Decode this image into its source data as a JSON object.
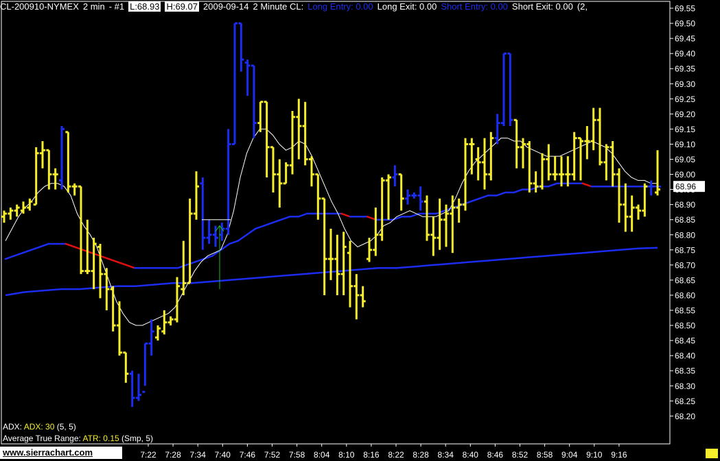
{
  "header": {
    "symbol": "CL-200910-NYMEX",
    "interval": "2 min",
    "chart_num": "- #1",
    "low": "L:68.93",
    "high": "H:69.07",
    "date": "2009-09-14",
    "study_name": "2 Minute CL:",
    "long_entry": "Long Entry: 0.00",
    "long_exit": "Long Exit: 0.00",
    "short_entry": "Short Entry: 0.00",
    "short_exit": "Short Exit: 0.00",
    "tail": "(2,"
  },
  "studies": {
    "adx_label": "ADX:",
    "adx_value": "ADX: 30",
    "adx_params": "(5, 5)",
    "atr_label": "Average True Range:",
    "atr_value": "ATR: 0.15",
    "atr_params": "(Smp, 5)"
  },
  "brand": "www.sierrachart.com",
  "colors": {
    "bar_up": "#f6ee2c",
    "bar_down": "#1c2cf0",
    "ma_fast": "#ffffff",
    "ma_blue": "#1c2cf0",
    "ma_red": "#e01010",
    "signal": "#18c018",
    "grid": "#ffffff"
  },
  "chart_data": {
    "type": "ohlc",
    "title": "CL-200910-NYMEX 2 min",
    "y_ticks": [
      "69.55",
      "69.50",
      "69.45",
      "69.40",
      "69.35",
      "69.30",
      "69.25",
      "69.20",
      "69.15",
      "69.10",
      "69.05",
      "69.00",
      "68.95",
      "68.90",
      "68.85",
      "68.80",
      "68.75",
      "68.70",
      "68.65",
      "68.60",
      "68.55",
      "68.50",
      "68.45",
      "68.40",
      "68.35",
      "68.30",
      "68.25",
      "68.20"
    ],
    "ylim": [
      68.15,
      69.58
    ],
    "last_price": "68.96",
    "x_ticks": [
      "7:22",
      "7:28",
      "7:34",
      "7:40",
      "7:46",
      "7:52",
      "7:58",
      "8:04",
      "8:10",
      "8:16",
      "8:22",
      "8:28",
      "8:34",
      "8:40",
      "8:46",
      "8:52",
      "8:58",
      "9:04",
      "9:10",
      "9:16"
    ],
    "bars": [
      {
        "o": 68.86,
        "h": 68.88,
        "l": 68.84,
        "c": 68.87,
        "d": "up"
      },
      {
        "o": 68.87,
        "h": 68.89,
        "l": 68.85,
        "c": 68.88,
        "d": "up"
      },
      {
        "o": 68.88,
        "h": 68.9,
        "l": 68.86,
        "c": 68.89,
        "d": "up"
      },
      {
        "o": 68.88,
        "h": 68.91,
        "l": 68.87,
        "c": 68.89,
        "d": "up"
      },
      {
        "o": 68.89,
        "h": 68.92,
        "l": 68.88,
        "c": 68.91,
        "d": "up"
      },
      {
        "o": 68.9,
        "h": 69.09,
        "l": 68.9,
        "c": 69.07,
        "d": "up"
      },
      {
        "o": 69.07,
        "h": 69.11,
        "l": 69.02,
        "c": 69.08,
        "d": "up"
      },
      {
        "o": 69.08,
        "h": 69.08,
        "l": 68.95,
        "c": 69.0,
        "d": "up"
      },
      {
        "o": 69.0,
        "h": 69.02,
        "l": 68.95,
        "c": 69.0,
        "d": "up"
      },
      {
        "o": 68.98,
        "h": 69.16,
        "l": 68.95,
        "c": 69.15,
        "d": "down"
      },
      {
        "o": 69.14,
        "h": 69.14,
        "l": 68.94,
        "c": 68.96,
        "d": "up"
      },
      {
        "o": 68.96,
        "h": 68.97,
        "l": 68.93,
        "c": 68.96,
        "d": "up"
      },
      {
        "o": 68.96,
        "h": 68.96,
        "l": 68.67,
        "c": 68.68,
        "d": "up"
      },
      {
        "o": 68.68,
        "h": 68.85,
        "l": 68.67,
        "c": 68.68,
        "d": "up"
      },
      {
        "o": 68.68,
        "h": 68.79,
        "l": 68.62,
        "c": 68.77,
        "d": "up"
      },
      {
        "o": 68.76,
        "h": 68.77,
        "l": 68.59,
        "c": 68.67,
        "d": "up"
      },
      {
        "o": 68.67,
        "h": 68.69,
        "l": 68.55,
        "c": 68.62,
        "d": "up"
      },
      {
        "o": 68.62,
        "h": 68.63,
        "l": 68.48,
        "c": 68.5,
        "d": "up"
      },
      {
        "o": 68.5,
        "h": 68.58,
        "l": 68.4,
        "c": 68.41,
        "d": "up"
      },
      {
        "o": 68.41,
        "h": 68.41,
        "l": 68.31,
        "c": 68.34,
        "d": "up"
      },
      {
        "o": 68.34,
        "h": 68.35,
        "l": 68.23,
        "c": 68.26,
        "d": "down"
      },
      {
        "o": 68.26,
        "h": 68.34,
        "l": 68.25,
        "c": 68.27,
        "d": "down"
      },
      {
        "o": 68.28,
        "h": 68.44,
        "l": 68.3,
        "c": 68.44,
        "d": "down"
      },
      {
        "o": 68.44,
        "h": 68.52,
        "l": 68.4,
        "c": 68.48,
        "d": "down"
      },
      {
        "o": 68.46,
        "h": 68.5,
        "l": 68.45,
        "c": 68.49,
        "d": "up"
      },
      {
        "o": 68.48,
        "h": 68.55,
        "l": 68.47,
        "c": 68.51,
        "d": "up"
      },
      {
        "o": 68.51,
        "h": 68.53,
        "l": 68.5,
        "c": 68.52,
        "d": "up"
      },
      {
        "o": 68.52,
        "h": 68.66,
        "l": 68.51,
        "c": 68.63,
        "d": "up"
      },
      {
        "o": 68.62,
        "h": 68.78,
        "l": 68.6,
        "c": 68.64,
        "d": "up"
      },
      {
        "o": 68.64,
        "h": 68.92,
        "l": 68.64,
        "c": 68.87,
        "d": "up"
      },
      {
        "o": 68.87,
        "h": 69.01,
        "l": 68.85,
        "c": 68.96,
        "d": "up"
      },
      {
        "o": 68.97,
        "h": 68.99,
        "l": 68.75,
        "c": 68.79,
        "d": "down"
      },
      {
        "o": 68.79,
        "h": 68.85,
        "l": 68.77,
        "c": 68.8,
        "d": "down"
      },
      {
        "o": 68.8,
        "h": 68.83,
        "l": 68.76,
        "c": 68.79,
        "d": "down"
      },
      {
        "o": 68.8,
        "h": 68.84,
        "l": 68.78,
        "c": 68.82,
        "d": "down"
      },
      {
        "o": 68.82,
        "h": 69.15,
        "l": 68.8,
        "c": 69.1,
        "d": "down"
      },
      {
        "o": 69.1,
        "h": 69.5,
        "l": 69.1,
        "c": 69.5,
        "d": "down"
      },
      {
        "o": 69.5,
        "h": 69.5,
        "l": 69.34,
        "c": 69.38,
        "d": "down"
      },
      {
        "o": 69.37,
        "h": 69.38,
        "l": 69.26,
        "c": 69.36,
        "d": "down"
      },
      {
        "o": 69.36,
        "h": 69.36,
        "l": 69.12,
        "c": 69.17,
        "d": "down"
      },
      {
        "o": 69.17,
        "h": 69.24,
        "l": 69.14,
        "c": 69.24,
        "d": "up"
      },
      {
        "o": 69.24,
        "h": 69.24,
        "l": 68.99,
        "c": 69.09,
        "d": "up"
      },
      {
        "o": 69.09,
        "h": 69.09,
        "l": 68.94,
        "c": 69.0,
        "d": "up"
      },
      {
        "o": 69.0,
        "h": 69.05,
        "l": 68.89,
        "c": 68.97,
        "d": "up"
      },
      {
        "o": 68.97,
        "h": 69.04,
        "l": 68.97,
        "c": 69.03,
        "d": "up"
      },
      {
        "o": 69.03,
        "h": 69.21,
        "l": 69.0,
        "c": 69.19,
        "d": "up"
      },
      {
        "o": 69.19,
        "h": 69.25,
        "l": 69.05,
        "c": 69.16,
        "d": "up"
      },
      {
        "o": 69.16,
        "h": 69.24,
        "l": 69.03,
        "c": 69.05,
        "d": "up"
      },
      {
        "o": 69.05,
        "h": 69.06,
        "l": 68.96,
        "c": 69.0,
        "d": "up"
      },
      {
        "o": 69.0,
        "h": 69.0,
        "l": 68.85,
        "c": 68.92,
        "d": "up"
      },
      {
        "o": 68.92,
        "h": 68.92,
        "l": 68.6,
        "c": 68.72,
        "d": "up"
      },
      {
        "o": 68.72,
        "h": 68.82,
        "l": 68.65,
        "c": 68.72,
        "d": "up"
      },
      {
        "o": 68.72,
        "h": 68.8,
        "l": 68.6,
        "c": 68.67,
        "d": "up"
      },
      {
        "o": 68.67,
        "h": 68.81,
        "l": 68.6,
        "c": 68.76,
        "d": "up"
      },
      {
        "o": 68.74,
        "h": 68.78,
        "l": 68.56,
        "c": 68.63,
        "d": "up"
      },
      {
        "o": 68.63,
        "h": 68.67,
        "l": 68.52,
        "c": 68.6,
        "d": "up"
      },
      {
        "o": 68.6,
        "h": 68.63,
        "l": 68.56,
        "c": 68.58,
        "d": "up"
      },
      {
        "o": 68.72,
        "h": 68.79,
        "l": 68.71,
        "c": 68.75,
        "d": "up"
      },
      {
        "o": 68.75,
        "h": 68.89,
        "l": 68.73,
        "c": 68.8,
        "d": "up"
      },
      {
        "o": 68.8,
        "h": 68.99,
        "l": 68.78,
        "c": 68.98,
        "d": "up"
      },
      {
        "o": 68.98,
        "h": 69.0,
        "l": 68.85,
        "c": 68.99,
        "d": "up"
      },
      {
        "o": 68.99,
        "h": 69.03,
        "l": 68.96,
        "c": 69.0,
        "d": "down"
      },
      {
        "o": 69.0,
        "h": 69.0,
        "l": 68.88,
        "c": 68.92,
        "d": "up"
      },
      {
        "o": 68.92,
        "h": 68.95,
        "l": 68.9,
        "c": 68.93,
        "d": "down"
      },
      {
        "o": 68.93,
        "h": 68.94,
        "l": 68.92,
        "c": 68.93,
        "d": "down"
      },
      {
        "o": 68.93,
        "h": 68.96,
        "l": 68.88,
        "c": 68.91,
        "d": "down"
      },
      {
        "o": 68.91,
        "h": 68.93,
        "l": 68.78,
        "c": 68.8,
        "d": "up"
      },
      {
        "o": 68.8,
        "h": 68.86,
        "l": 68.73,
        "c": 68.79,
        "d": "up"
      },
      {
        "o": 68.79,
        "h": 68.92,
        "l": 68.75,
        "c": 68.85,
        "d": "up"
      },
      {
        "o": 68.85,
        "h": 68.9,
        "l": 68.76,
        "c": 68.87,
        "d": "up"
      },
      {
        "o": 68.87,
        "h": 68.93,
        "l": 68.74,
        "c": 68.89,
        "d": "up"
      },
      {
        "o": 68.89,
        "h": 68.92,
        "l": 68.84,
        "c": 68.9,
        "d": "up"
      },
      {
        "o": 68.9,
        "h": 69.12,
        "l": 68.88,
        "c": 69.1,
        "d": "up"
      },
      {
        "o": 69.1,
        "h": 69.12,
        "l": 69.0,
        "c": 69.1,
        "d": "up"
      },
      {
        "o": 69.05,
        "h": 69.09,
        "l": 68.98,
        "c": 69.04,
        "d": "up"
      },
      {
        "o": 69.04,
        "h": 69.12,
        "l": 68.95,
        "c": 69.0,
        "d": "up"
      },
      {
        "o": 69.0,
        "h": 69.14,
        "l": 68.98,
        "c": 69.12,
        "d": "up"
      },
      {
        "o": 69.12,
        "h": 69.2,
        "l": 69.1,
        "c": 69.17,
        "d": "down"
      },
      {
        "o": 69.17,
        "h": 69.4,
        "l": 69.16,
        "c": 69.4,
        "d": "down"
      },
      {
        "o": 69.4,
        "h": 69.4,
        "l": 69.16,
        "c": 69.18,
        "d": "down"
      },
      {
        "o": 69.18,
        "h": 69.18,
        "l": 69.02,
        "c": 69.09,
        "d": "up"
      },
      {
        "o": 69.09,
        "h": 69.12,
        "l": 69.02,
        "c": 69.1,
        "d": "up"
      },
      {
        "o": 69.1,
        "h": 69.11,
        "l": 68.94,
        "c": 68.97,
        "d": "up"
      },
      {
        "o": 68.97,
        "h": 69.01,
        "l": 68.94,
        "c": 68.96,
        "d": "up"
      },
      {
        "o": 68.96,
        "h": 69.07,
        "l": 68.95,
        "c": 69.05,
        "d": "up"
      },
      {
        "o": 69.05,
        "h": 69.1,
        "l": 68.98,
        "c": 69.0,
        "d": "up"
      },
      {
        "o": 69.0,
        "h": 69.06,
        "l": 68.98,
        "c": 69.0,
        "d": "up"
      },
      {
        "o": 69.0,
        "h": 69.06,
        "l": 68.96,
        "c": 69.0,
        "d": "up"
      },
      {
        "o": 69.0,
        "h": 69.06,
        "l": 68.96,
        "c": 69.0,
        "d": "up"
      },
      {
        "o": 69.0,
        "h": 69.14,
        "l": 68.98,
        "c": 69.12,
        "d": "up"
      },
      {
        "o": 69.12,
        "h": 69.12,
        "l": 68.98,
        "c": 69.11,
        "d": "up"
      },
      {
        "o": 69.11,
        "h": 69.16,
        "l": 69.05,
        "c": 69.11,
        "d": "up"
      },
      {
        "o": 69.11,
        "h": 69.22,
        "l": 69.08,
        "c": 69.18,
        "d": "up"
      },
      {
        "o": 69.18,
        "h": 69.22,
        "l": 69.03,
        "c": 69.04,
        "d": "up"
      },
      {
        "o": 69.04,
        "h": 69.1,
        "l": 68.98,
        "c": 69.09,
        "d": "up"
      },
      {
        "o": 69.09,
        "h": 69.11,
        "l": 68.96,
        "c": 69.0,
        "d": "up"
      },
      {
        "o": 69.0,
        "h": 69.02,
        "l": 68.84,
        "c": 68.9,
        "d": "up"
      },
      {
        "o": 68.9,
        "h": 68.97,
        "l": 68.81,
        "c": 68.86,
        "d": "up"
      },
      {
        "o": 68.86,
        "h": 68.93,
        "l": 68.81,
        "c": 68.89,
        "d": "up"
      },
      {
        "o": 68.89,
        "h": 68.9,
        "l": 68.85,
        "c": 68.88,
        "d": "up"
      },
      {
        "o": 68.88,
        "h": 68.97,
        "l": 68.86,
        "c": 68.96,
        "d": "up"
      },
      {
        "o": 68.96,
        "h": 68.98,
        "l": 68.93,
        "c": 68.96,
        "d": "down"
      },
      {
        "o": 68.94,
        "h": 69.08,
        "l": 68.93,
        "c": 68.95,
        "d": "up"
      }
    ],
    "ma_fast": [
      68.78,
      68.82,
      68.86,
      68.89,
      68.91,
      68.94,
      68.96,
      68.97,
      68.97,
      68.96,
      68.93,
      68.87,
      68.83,
      68.8,
      68.76,
      68.7,
      68.64,
      68.58,
      68.54,
      68.51,
      68.5,
      68.5,
      68.51,
      68.52,
      68.53,
      68.54,
      68.56,
      68.6,
      68.64,
      68.68,
      68.71,
      68.73,
      68.74,
      68.75,
      68.8,
      68.88,
      68.99,
      69.07,
      69.12,
      69.15,
      69.15,
      69.13,
      69.1,
      69.08,
      69.09,
      69.11,
      69.1,
      69.06,
      69.01,
      68.96,
      68.91,
      68.87,
      68.82,
      68.78,
      68.76,
      68.77,
      68.78,
      68.8,
      68.83,
      68.84,
      68.86,
      68.87,
      68.88,
      68.87,
      68.86,
      68.86,
      68.86,
      68.87,
      68.88,
      68.92,
      68.97,
      69.01,
      69.04,
      69.06,
      69.08,
      69.1,
      69.12,
      69.12,
      69.11,
      69.11,
      69.09,
      69.08,
      69.07,
      69.06,
      69.06,
      69.06,
      69.07,
      69.08,
      69.09,
      69.1,
      69.11,
      69.1,
      69.09,
      69.07,
      69.04,
      69.01,
      68.99,
      68.98,
      68.98,
      68.97,
      68.97
    ],
    "ma_mid": [
      68.72,
      68.73,
      68.74,
      68.75,
      68.76,
      68.77,
      68.77,
      68.77,
      68.76,
      68.75,
      68.74,
      68.73,
      68.72,
      68.71,
      68.7,
      68.69,
      68.69,
      68.69,
      68.69,
      68.69,
      68.69,
      68.7,
      68.71,
      68.72,
      68.73,
      68.75,
      68.77,
      68.78,
      68.8,
      68.82,
      68.83,
      68.84,
      68.85,
      68.86,
      68.86,
      68.87,
      68.87,
      68.87,
      68.87,
      68.87,
      68.86,
      68.86,
      68.86,
      68.85,
      68.85,
      68.85,
      68.86,
      68.86,
      68.87,
      68.87,
      68.87,
      68.88,
      68.89,
      68.9,
      68.91,
      68.92,
      68.93,
      68.93,
      68.94,
      68.94,
      68.95,
      68.95,
      68.96,
      68.96,
      68.97,
      68.97,
      68.97,
      68.97,
      68.96,
      68.96,
      68.96,
      68.96,
      68.96,
      68.96,
      68.96,
      68.96,
      68.96
    ],
    "ma_slow": [
      68.6,
      68.61,
      68.615,
      68.62,
      68.62,
      68.625,
      68.63,
      68.63,
      68.635,
      68.64,
      68.64,
      68.645,
      68.65,
      68.655,
      68.66,
      68.665,
      68.67,
      68.675,
      68.68,
      68.685,
      68.69,
      68.69,
      68.695,
      68.7,
      68.705,
      68.71,
      68.715,
      68.72,
      68.725,
      68.73,
      68.735,
      68.74,
      68.745,
      68.75,
      68.755,
      68.757
    ],
    "signal_price": 68.83,
    "signal_marker_price": 68.85,
    "signal_base_price": 68.62
  }
}
